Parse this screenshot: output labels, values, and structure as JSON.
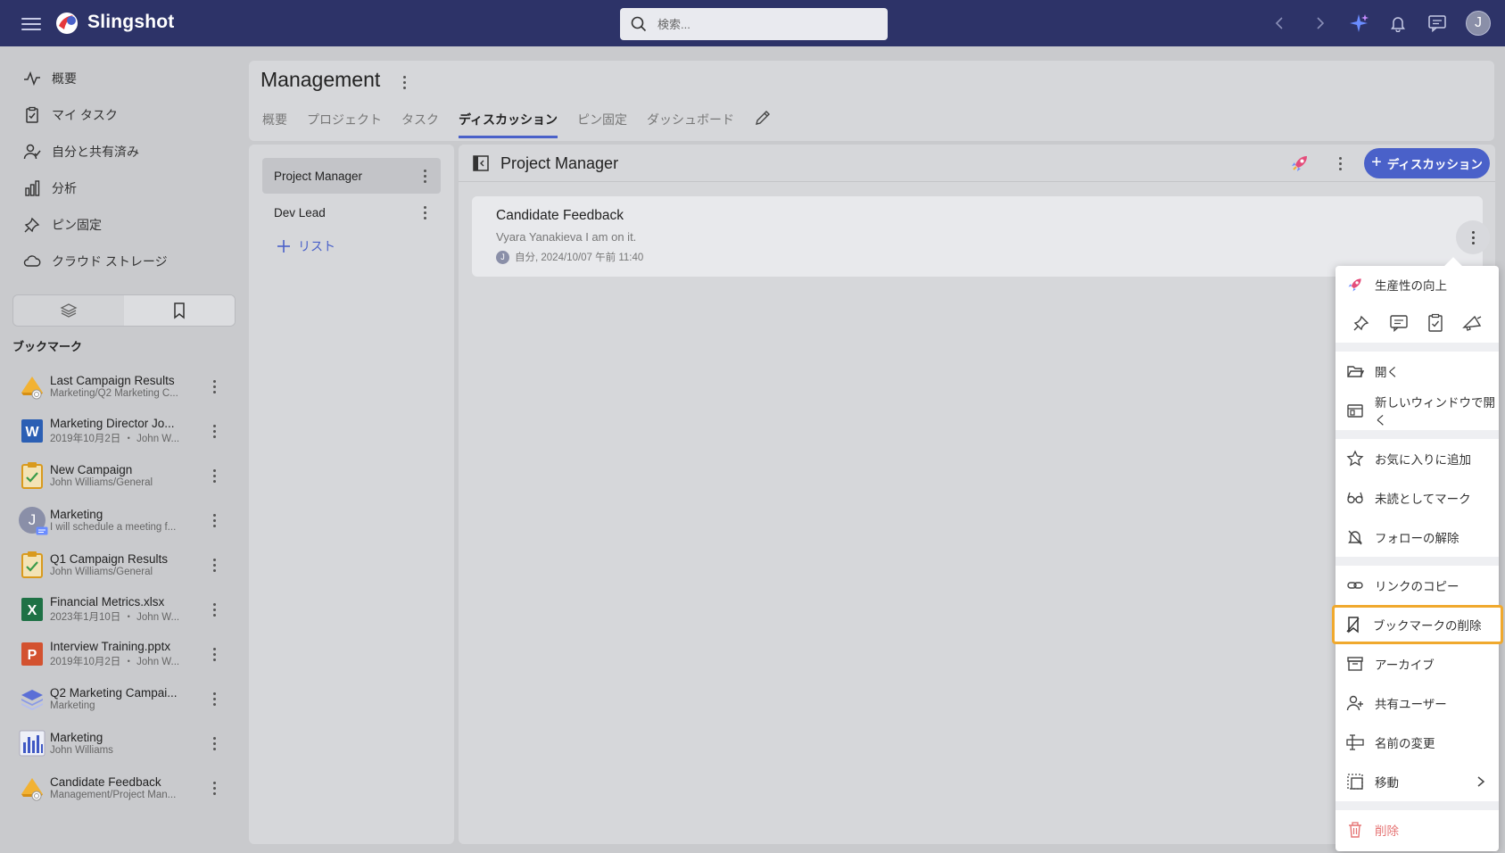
{
  "app": {
    "name": "Slingshot",
    "search_placeholder": "検索..."
  },
  "topbar": {
    "user_initial": "J"
  },
  "leftnav": {
    "items": [
      {
        "label": "概要"
      },
      {
        "label": "マイ タスク"
      },
      {
        "label": "自分と共有済み"
      },
      {
        "label": "分析"
      },
      {
        "label": "ピン固定"
      },
      {
        "label": "クラウド ストレージ"
      }
    ],
    "bookmarks_title": "ブックマーク",
    "bookmarks": [
      {
        "name": "Last Campaign Results",
        "sub": "Marketing/Q2 Marketing C...",
        "icon": "megaphone-icon"
      },
      {
        "name": "Marketing Director Jo...",
        "sub": "2019年10月2日 ・ John W...",
        "icon": "word-file-icon"
      },
      {
        "name": "New Campaign",
        "sub": "John Williams/General",
        "icon": "clipboard-task-icon"
      },
      {
        "name": "Marketing",
        "sub": "I will schedule a meeting f...",
        "icon": "user-chat-icon",
        "initial": "J"
      },
      {
        "name": "Q1 Campaign Results",
        "sub": "John Williams/General",
        "icon": "clipboard-task-icon"
      },
      {
        "name": "Financial Metrics.xlsx",
        "sub": "2023年1月10日 ・ John W...",
        "icon": "excel-file-icon"
      },
      {
        "name": "Interview Training.pptx",
        "sub": "2019年10月2日 ・ John W...",
        "icon": "powerpoint-file-icon"
      },
      {
        "name": "Q2 Marketing Campai...",
        "sub": "Marketing",
        "icon": "layers-icon"
      },
      {
        "name": "Marketing",
        "sub": "John Williams",
        "icon": "bar-chart-icon"
      },
      {
        "name": "Candidate Feedback",
        "sub": "Management/Project Man...",
        "icon": "megaphone-icon"
      }
    ]
  },
  "header": {
    "title": "Management",
    "tabs": [
      {
        "label": "概要"
      },
      {
        "label": "プロジェクト"
      },
      {
        "label": "タスク"
      },
      {
        "label": "ディスカッション"
      },
      {
        "label": "ピン固定"
      },
      {
        "label": "ダッシュボード"
      }
    ]
  },
  "lists": {
    "items": [
      {
        "label": "Project Manager"
      },
      {
        "label": "Dev Lead"
      }
    ],
    "add_label": "リスト"
  },
  "discussion": {
    "title": "Project Manager",
    "new_button": "ディスカッション",
    "card": {
      "title": "Candidate Feedback",
      "preview": "Vyara Yanakieva I am on it.",
      "meta": "自分, 2024/10/07 午前 11:40",
      "initial": "J"
    }
  },
  "context_menu": {
    "productivity": "生産性の向上",
    "open": "開く",
    "open_new_window": "新しいウィンドウで開く",
    "add_favorite": "お気に入りに追加",
    "mark_unread": "未読としてマーク",
    "unfollow": "フォローの解除",
    "copy_link": "リンクのコピー",
    "remove_bookmark": "ブックマークの削除",
    "archive": "アーカイブ",
    "shared_users": "共有ユーザー",
    "rename": "名前の変更",
    "move": "移動",
    "delete": "削除"
  },
  "colors": {
    "topbar": "#2d3368",
    "accent": "#4a61c9",
    "highlight": "#f0a92e",
    "danger": "#e57373"
  }
}
